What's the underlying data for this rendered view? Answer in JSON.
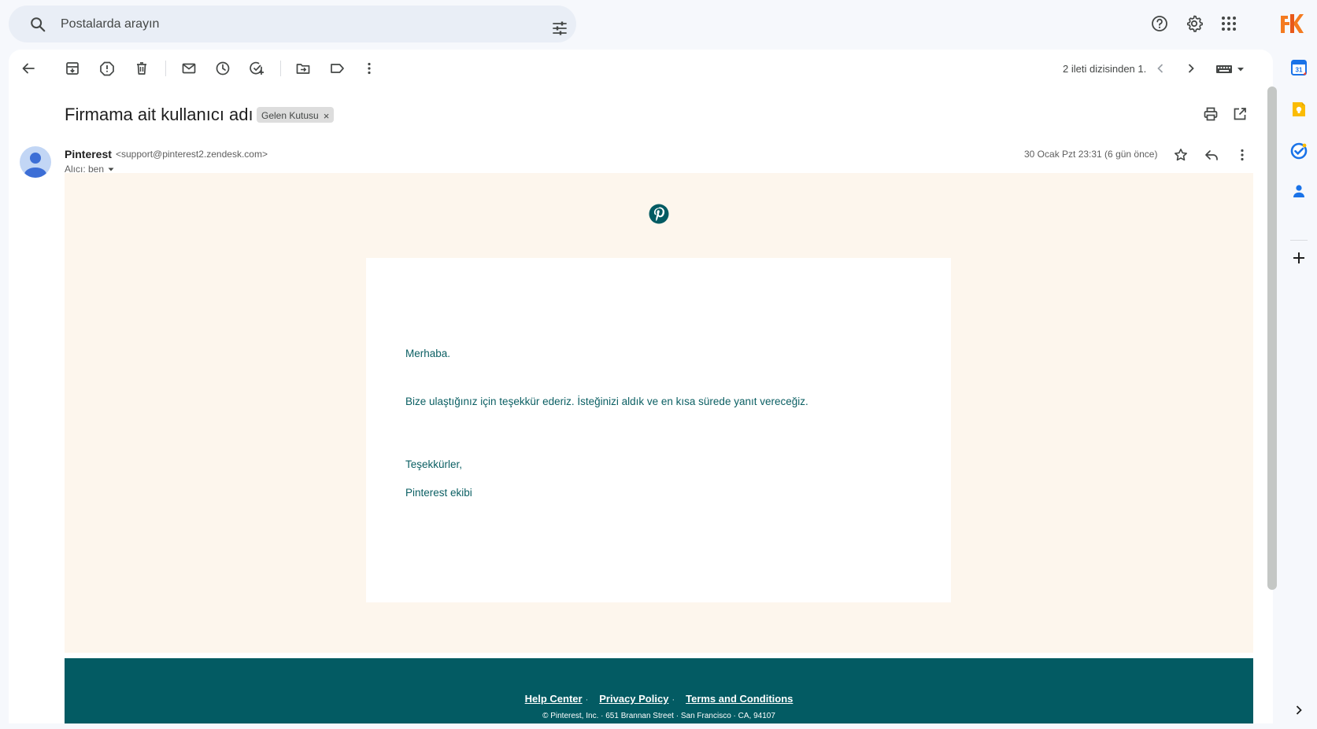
{
  "search": {
    "placeholder": "Postalarda arayın",
    "icon": "search-icon",
    "filter_icon": "tune-icon"
  },
  "header_icons": [
    "help-icon",
    "settings-gear-icon",
    "apps-grid-icon",
    "account-logo"
  ],
  "toolbar": {
    "icons": [
      "back-arrow-icon",
      "archive-icon",
      "report-spam-icon",
      "delete-icon",
      "mark-unread-icon",
      "snooze-icon",
      "add-task-icon",
      "move-to-icon",
      "label-icon",
      "more-vert-icon"
    ],
    "pager_text": "2 ileti dizisinden 1.",
    "keyboard_icon": "keyboard-icon"
  },
  "thread": {
    "subject": "Firmama ait kullanıcı adı",
    "label_chip": "Gelen Kutusu",
    "label_remove": "×"
  },
  "message": {
    "sender_name": "Pinterest",
    "sender_email": "<support@pinterest2.zendesk.com>",
    "recipient": "Alıcı: ben",
    "date": "30 Ocak Pzt 23:31 (6 gün önce)"
  },
  "email": {
    "greeting": "Merhaba.",
    "body": "Bize ulaştığınız için teşekkür ederiz. İsteğinizi aldık ve en kısa sürede yanıt vereceğiz.",
    "closing": "Teşekkürler,",
    "signature": "Pinterest ekibi",
    "brand_color": "#035b63",
    "background_color": "#fdf6ed"
  },
  "footer": {
    "links": [
      "Help Center",
      "Privacy Policy",
      "Terms and Conditions"
    ],
    "separator": "·",
    "address": "© Pinterest, Inc. · 651 Brannan Street · San Francisco · CA, 94107"
  },
  "side_panel": {
    "apps": [
      "calendar-icon",
      "keep-icon",
      "tasks-icon",
      "contacts-icon",
      "add-icon"
    ],
    "expand_icon": "chevron-right-icon"
  }
}
